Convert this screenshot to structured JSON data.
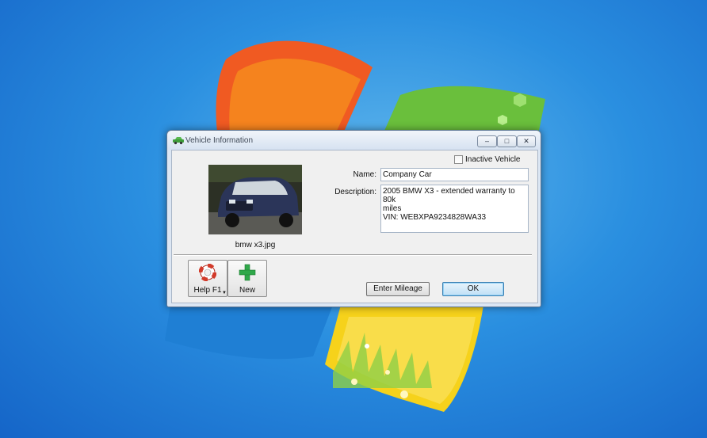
{
  "window": {
    "title": "Vehicle Information",
    "controls": {
      "minimize": "–",
      "maximize": "□",
      "close": "✕"
    }
  },
  "vehicle": {
    "photo_caption": "bmw x3.jpg",
    "inactive_label": "Inactive Vehicle",
    "inactive_checked": false,
    "name_label": "Name:",
    "name_value": "Company Car",
    "description_label": "Description:",
    "description_value": "2005 BMW X3 - extended warranty to 80k\nmiles\nVIN: WEBXPA9234828WA33"
  },
  "toolbar": {
    "help_label": "Help F1",
    "new_label": "New"
  },
  "buttons": {
    "enter_mileage_label": "Enter Mileage",
    "ok_label": "OK"
  },
  "icons": {
    "window_icon": "car-icon",
    "help_icon": "lifebuoy-icon",
    "new_icon": "plus-icon"
  },
  "colors": {
    "desktop_blue": "#2a8fe0",
    "ok_border": "#3c7fb1",
    "new_plus": "#2fa84a",
    "help_red": "#d23a2a"
  }
}
